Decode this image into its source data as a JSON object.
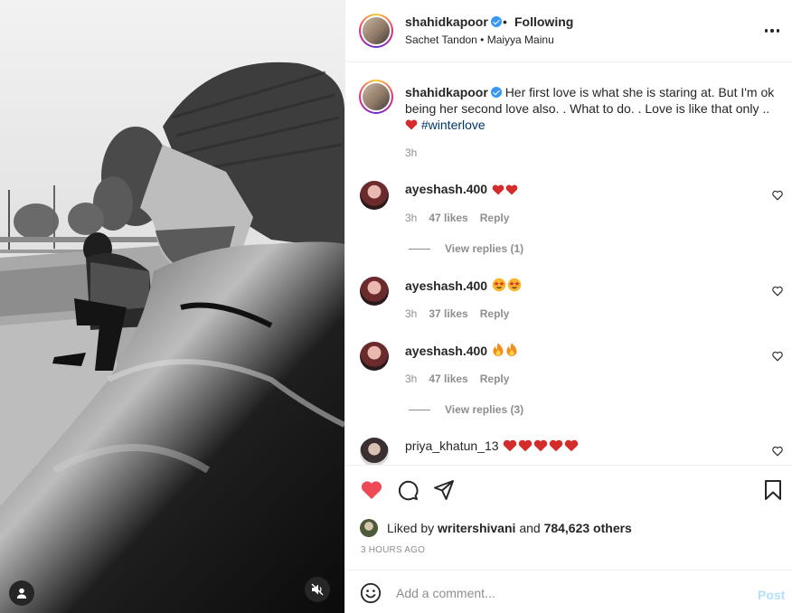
{
  "header": {
    "username": "shahidkapoor",
    "separator": "•",
    "follow_status": "Following",
    "audio": "Sachet Tandon • Maiyya Mainu"
  },
  "caption": {
    "username": "shahidkapoor",
    "text": "Her first love is what she is staring at. But I'm ok being her second love also. . What to do. . Love is like that only .. ",
    "hashtag": "#winterlove",
    "time": "3h"
  },
  "comments": [
    {
      "username": "ayeshash.400",
      "emojis": [
        "heart",
        "heart"
      ],
      "time": "3h",
      "likes": "47 likes",
      "reply": "Reply",
      "view_replies": "View replies (1)"
    },
    {
      "username": "ayeshash.400",
      "emojis": [
        "star-eyes",
        "star-eyes"
      ],
      "time": "3h",
      "likes": "37 likes",
      "reply": "Reply"
    },
    {
      "username": "ayeshash.400",
      "emojis": [
        "fire",
        "fire"
      ],
      "time": "3h",
      "likes": "47 likes",
      "reply": "Reply",
      "view_replies": "View replies (3)"
    },
    {
      "username": "priya_khatun_13",
      "emojis": [
        "heart",
        "heart",
        "heart",
        "heart",
        "heart"
      ]
    }
  ],
  "actions": {
    "liked_prefix": "Liked by",
    "liked_user": "writershivani",
    "liked_and": "and",
    "liked_count": "784,623 others",
    "post_time": "3 HOURS AGO"
  },
  "composer": {
    "placeholder": "Add a comment...",
    "post_label": "Post"
  },
  "colors": {
    "like_red": "#ed4956",
    "link_blue": "#00376b",
    "verified_blue": "#3897f0",
    "post_disabled": "#b2dffc"
  }
}
